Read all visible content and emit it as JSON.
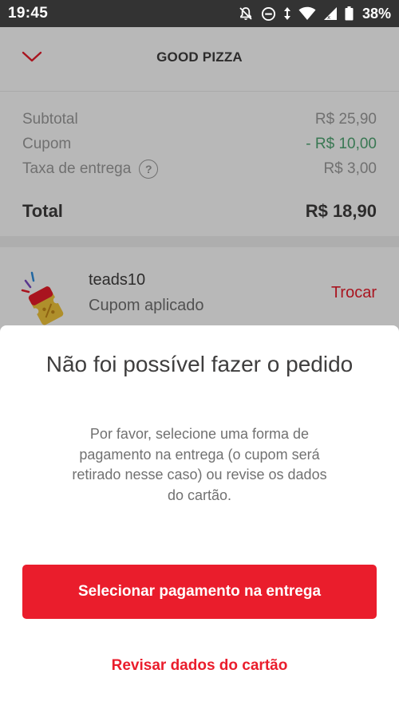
{
  "status_bar": {
    "time": "19:45",
    "battery": "38%"
  },
  "header": {
    "title": "GOOD PIZZA"
  },
  "summary": {
    "rows": [
      {
        "label": "Subtotal",
        "value": "R$  25,90"
      },
      {
        "label": "Cupom",
        "value": "- R$  10,00"
      },
      {
        "label": "Taxa de entrega",
        "help": "?",
        "value": "R$  3,00"
      }
    ],
    "total_label": "Total",
    "total_value": "R$  18,90"
  },
  "coupon": {
    "code": "teads10",
    "status": "Cupom aplicado",
    "change_label": "Trocar"
  },
  "modal": {
    "title": "Não foi possível fazer o pedido",
    "message": "Por favor, selecione uma forma de pagamento na entrega (o cupom será retirado nesse caso) ou revise os dados do cartão.",
    "primary_button": "Selecionar pagamento na entrega",
    "secondary_button": "Revisar dados do cartão"
  },
  "colors": {
    "brand_red": "#ea1d2c",
    "discount_green": "#50a773",
    "overlay": "rgba(0,0,0,0.28)"
  },
  "icons": [
    "notifications-off-icon",
    "do-not-disturb-icon",
    "data-arrows-icon",
    "wifi-icon",
    "signal-icon",
    "battery-icon",
    "chevron-down-icon",
    "help-icon",
    "coupon-ticket-icon"
  ]
}
